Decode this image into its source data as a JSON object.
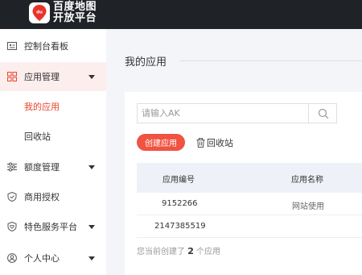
{
  "brand": {
    "line1": "百度地图",
    "line2": "开放平台"
  },
  "sidebar": {
    "items": [
      {
        "label": "控制台看板",
        "icon": "dashboard-icon"
      },
      {
        "label": "应用管理",
        "icon": "grid-icon"
      },
      {
        "label": "我的应用"
      },
      {
        "label": "回收站"
      },
      {
        "label": "额度管理",
        "icon": "sliders-icon"
      },
      {
        "label": "商用授权",
        "icon": "shield-icon"
      },
      {
        "label": "特色服务平台",
        "icon": "heart-shield-icon"
      },
      {
        "label": "个人中心",
        "icon": "user-circle-icon"
      }
    ]
  },
  "main": {
    "title": "我的应用",
    "search": {
      "placeholder": "请输入AK",
      "value": ""
    },
    "create_label": "创建应用",
    "recycle_label": "回收站",
    "table": {
      "headers": [
        "应用编号",
        "应用名称"
      ],
      "rows": [
        {
          "id": "9152266",
          "name": "网站使用"
        },
        {
          "id": "2147385519",
          "name": ""
        }
      ]
    },
    "footer": {
      "prefix": "您当前创建了",
      "count": "2",
      "suffix": "个应用"
    }
  },
  "colors": {
    "accent": "#f05341",
    "topbar": "#1f2227",
    "active_bg": "#fdeeee"
  }
}
